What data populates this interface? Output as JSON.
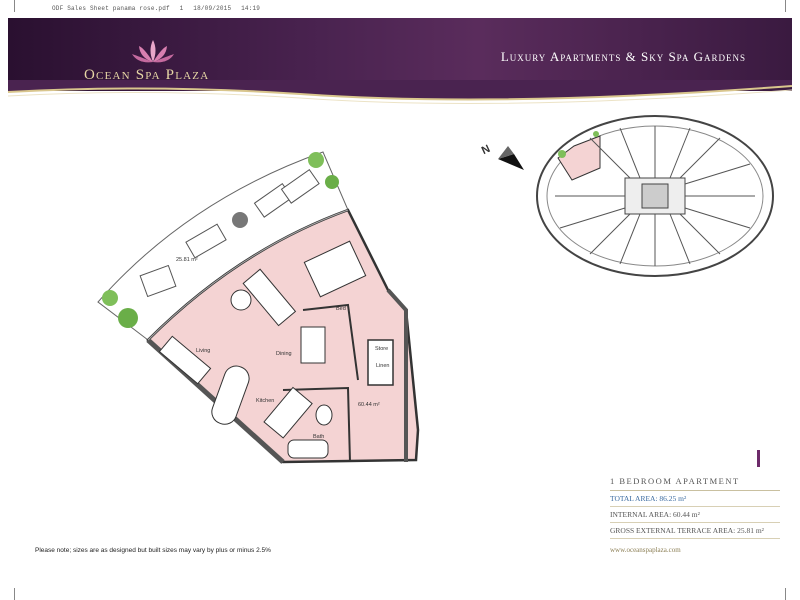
{
  "print_header": {
    "filename": "ODF Sales Sheet panama rose.pdf",
    "page": "1",
    "date": "18/09/2015",
    "time": "14:19"
  },
  "brand": {
    "name": "Ocean Spa Plaza",
    "tagline": "Luxury Apartments & Sky Spa Gardens",
    "website": "www.oceanspaplaza.com"
  },
  "floorplan": {
    "rooms": {
      "terrace_area": "25.81 m²",
      "living": "Living",
      "dining": "Dining",
      "bed": "Bed",
      "kitchen": "Kitchen",
      "bath": "Bath",
      "store": "Store",
      "linen": "Linen",
      "internal_area": "60.44 m²"
    },
    "compass_letter": "N"
  },
  "apartment": {
    "title": "1 Bedroom Apartment",
    "total_area": "TOTAL AREA: 86.25 m²",
    "internal_area": "INTERNAL AREA: 60.44 m²",
    "terrace_area": "GROSS EXTERNAL TERRACE AREA: 25.81 m²"
  },
  "note": "Please note; sizes are as designed but built sizes may vary by plus or minus 2.5%",
  "colors": {
    "banner": "#4a2350",
    "gold": "#e6d7a5",
    "apartment_fill": "#f4d3d3",
    "accent": "#6d2a6a",
    "total_blue": "#3a6aa0"
  }
}
